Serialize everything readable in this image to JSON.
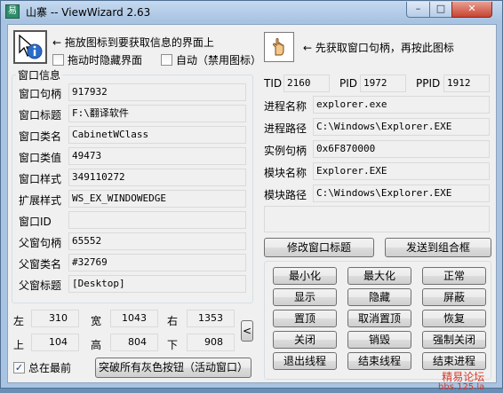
{
  "window": {
    "title": "山寨 -- ViewWizard 2.63",
    "controls": {
      "minimize": "–",
      "maximize": "□",
      "close": "✕"
    }
  },
  "picker": {
    "left_hint": "← 拖放图标到要获取信息的界面上",
    "right_hint": "← 先获取窗口句柄，再按此图标",
    "hide_on_drag_label": "拖动时隐藏界面",
    "hide_on_drag_checked": false,
    "auto_label": "自动（禁用图标）",
    "auto_checked": false
  },
  "window_info": {
    "group_title": "窗口信息",
    "rows": [
      {
        "label": "窗口句柄",
        "value": "917932"
      },
      {
        "label": "窗口标题",
        "value": "F:\\翻译软件"
      },
      {
        "label": "窗口类名",
        "value": "CabinetWClass"
      },
      {
        "label": "窗口类值",
        "value": "49473"
      },
      {
        "label": "窗口样式",
        "value": "349110272"
      },
      {
        "label": "扩展样式",
        "value": "WS_EX_WINDOWEDGE"
      },
      {
        "label": "窗口ID",
        "value": ""
      },
      {
        "label": "父窗句柄",
        "value": "65552"
      },
      {
        "label": "父窗类名",
        "value": "#32769"
      },
      {
        "label": "父窗标题",
        "value": "[Desktop]"
      }
    ]
  },
  "geometry": {
    "left_label": "左",
    "left": "310",
    "width_label": "宽",
    "width": "1043",
    "right_label": "右",
    "right": "1353",
    "top_label": "上",
    "top": "104",
    "height_label": "高",
    "height": "804",
    "bottom_label": "下",
    "bottom": "908",
    "collapse_arrow": "<"
  },
  "footer": {
    "topmost_label": "总在最前",
    "topmost_checked": true,
    "enable_gray_button": "突破所有灰色按钮（活动窗口）"
  },
  "process": {
    "tid_label": "TID",
    "tid": "2160",
    "pid_label": "PID",
    "pid": "1972",
    "ppid_label": "PPID",
    "ppid": "1912",
    "rows": [
      {
        "label": "进程名称",
        "value": "explorer.exe"
      },
      {
        "label": "进程路径",
        "value": "C:\\Windows\\Explorer.EXE"
      },
      {
        "label": "实例句柄",
        "value": "0x6F870000"
      },
      {
        "label": "模块名称",
        "value": "Explorer.EXE"
      },
      {
        "label": "模块路径",
        "value": "C:\\Windows\\Explorer.EXE"
      }
    ],
    "extra_value": ""
  },
  "actions": {
    "modify_title": "修改窗口标题",
    "send_to_combo": "发送到组合框",
    "grid": [
      [
        "最小化",
        "最大化",
        "正常"
      ],
      [
        "显示",
        "隐藏",
        "屏蔽"
      ],
      [
        "置顶",
        "取消置顶",
        "恢复"
      ],
      [
        "关闭",
        "销毁",
        "强制关闭"
      ],
      [
        "退出线程",
        "结束线程",
        "结束进程"
      ]
    ]
  },
  "watermark": {
    "line1": "精易论坛",
    "line2": "bbs.125.la"
  },
  "colors": {
    "frame": "#a9c4e2",
    "client": "#f0f0f0",
    "watermark": "#d43a2a"
  },
  "icons": {
    "app": "app-logo-icon",
    "left_picker": "info-target-icon",
    "right_picker": "hand-pointer-icon"
  }
}
